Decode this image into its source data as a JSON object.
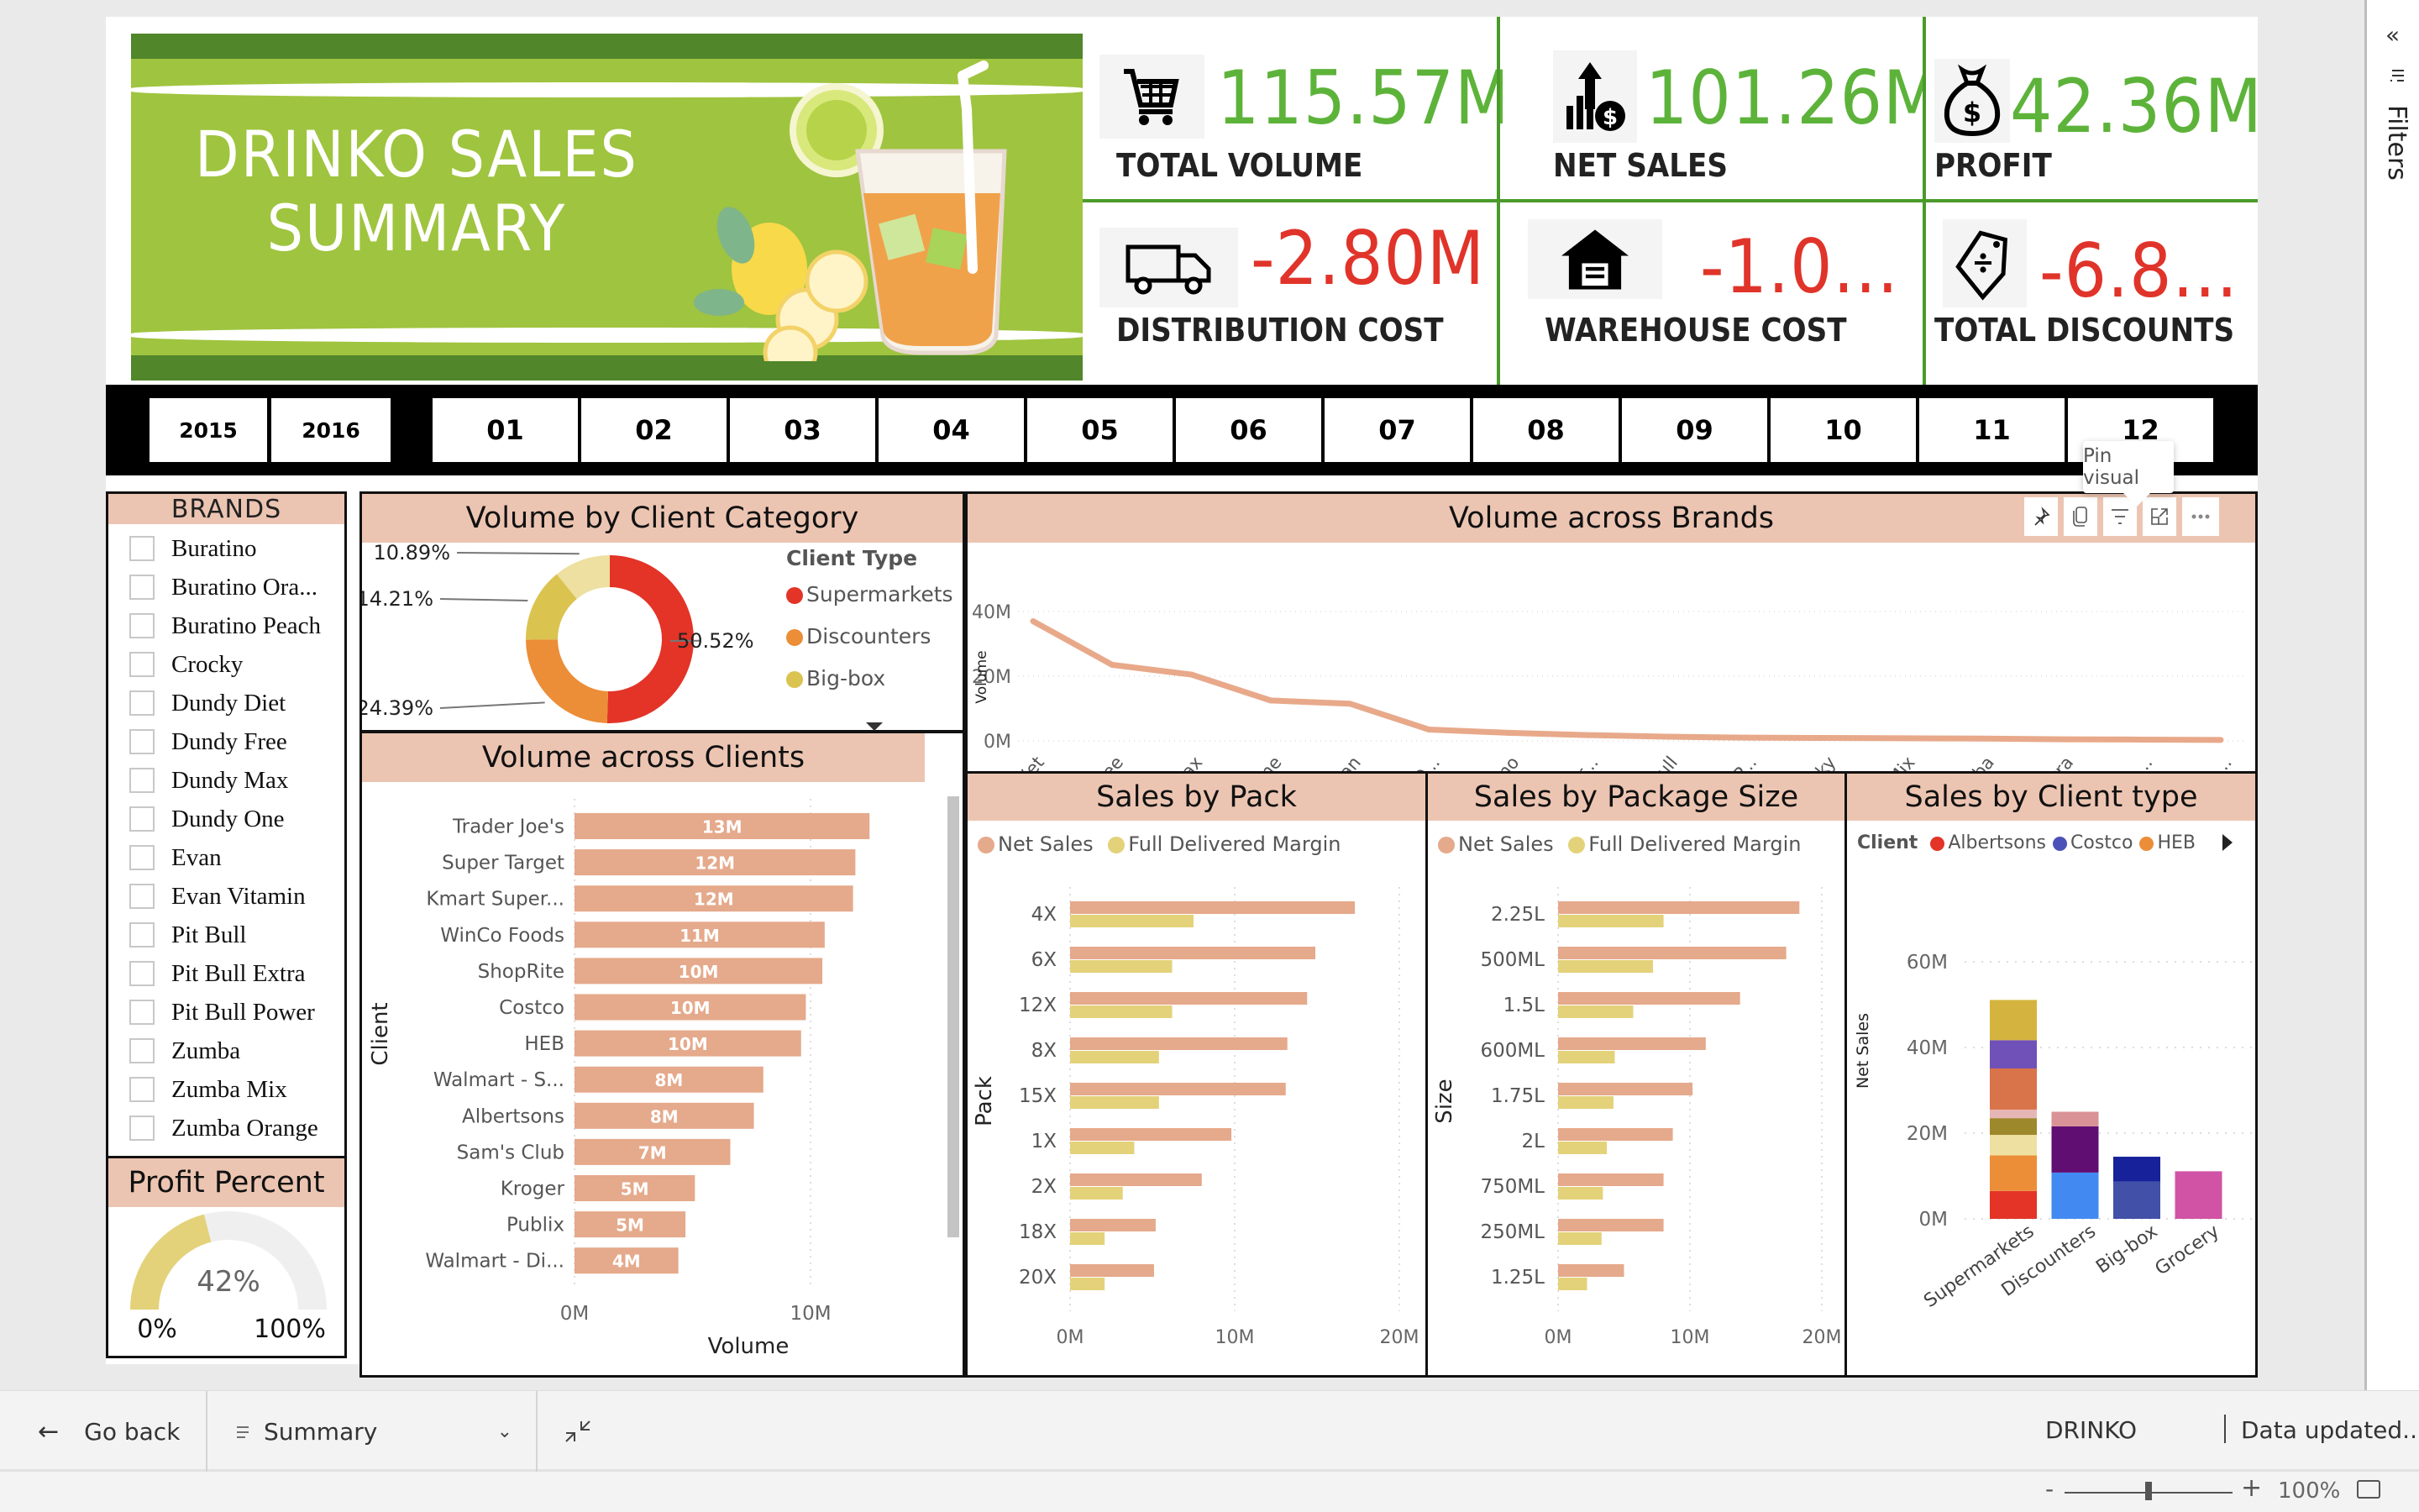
{
  "banner": {
    "title_line1": "DRINKO SALES",
    "title_line2": "SUMMARY"
  },
  "kpis": [
    {
      "id": "total-volume",
      "value": "115.57M",
      "label": "TOTAL VOLUME",
      "icon": "shopping-cart-icon",
      "color": "#5db33a"
    },
    {
      "id": "net-sales",
      "value": "101.26M",
      "label": "NET SALES",
      "icon": "growth-chart-dollar-icon",
      "color": "#5db33a"
    },
    {
      "id": "profit",
      "value": "42.36M",
      "label": "PROFIT",
      "icon": "money-bag-icon",
      "color": "#5db33a"
    },
    {
      "id": "distribution-cost",
      "value": "-2.80M",
      "label": "DISTRIBUTION COST",
      "icon": "delivery-truck-icon",
      "color": "#e0342a"
    },
    {
      "id": "warehouse-cost",
      "value": "-1.0...",
      "label": "WAREHOUSE COST",
      "icon": "warehouse-icon",
      "color": "#e0342a"
    },
    {
      "id": "total-discounts",
      "value": "-6.8...",
      "label": "TOTAL DISCOUNTS",
      "icon": "discount-tag-icon",
      "color": "#e0342a"
    }
  ],
  "years": [
    "2015",
    "2016"
  ],
  "months": [
    "01",
    "02",
    "03",
    "04",
    "05",
    "06",
    "07",
    "08",
    "09",
    "10",
    "11",
    "12"
  ],
  "brands_slicer": {
    "title": "BRANDS",
    "items": [
      "Buratino",
      "Buratino Ora...",
      "Buratino Peach",
      "Crocky",
      "Dundy Diet",
      "Dundy Free",
      "Dundy Max",
      "Dundy One",
      "Evan",
      "Evan Vitamin",
      "Pit Bull",
      "Pit Bull Extra",
      "Pit Bull Power",
      "Zumba",
      "Zumba Mix",
      "Zumba Orange"
    ]
  },
  "profit_gauge": {
    "title": "Profit Percent",
    "value_label": "42%",
    "value": 0.42,
    "min_label": "0%",
    "max_label": "100%",
    "fill_color": "#e3d27a"
  },
  "tooltip": {
    "text": "Pin visual"
  },
  "visual_header_icons": [
    "pin-icon",
    "copy-icon",
    "filter-icon",
    "focus-mode-icon",
    "more-options-icon"
  ],
  "bottom_bar": {
    "go_back": "Go back",
    "page": "Summary",
    "report_name": "DRINKO",
    "status": "Data updated...",
    "zoom": "100%",
    "zoom_level": 0.5
  },
  "filters_pane": {
    "label": "Filters"
  },
  "chart_data": [
    {
      "id": "volume-by-client-category",
      "type": "pie",
      "title": "Volume by Client Category",
      "legend_title": "Client Type",
      "legend": [
        {
          "name": "Supermarkets",
          "color": "#e33427"
        },
        {
          "name": "Discounters",
          "color": "#ec8d38"
        },
        {
          "name": "Big-box",
          "color": "#dbc350"
        }
      ],
      "slices": [
        {
          "name": "Supermarkets",
          "value": 50.52,
          "label": "50.52%",
          "color": "#e33427"
        },
        {
          "name": "Discounters",
          "value": 24.39,
          "label": "24.39%",
          "color": "#ec8d38"
        },
        {
          "name": "Big-box",
          "value": 14.21,
          "label": "14.21%",
          "color": "#dbc350"
        },
        {
          "name": "Grocery",
          "value": 10.89,
          "label": "10.89%",
          "color": "#ede0a0"
        }
      ]
    },
    {
      "id": "volume-across-brands",
      "type": "line",
      "title": "Volume across Brands",
      "ylabel": "Volume",
      "yticks": [
        "0M",
        "20M",
        "40M"
      ],
      "ylim": [
        0,
        40
      ],
      "categories": [
        "Dundy Diet",
        "Dundy Free",
        "Dundy Max",
        "Dundy One",
        "Evan",
        "Buratino O...",
        "Buratino",
        "Zumba Or...",
        "Pit Bull",
        "Buratino P...",
        "Crocky",
        "Zumba Mix",
        "Zumba",
        "Pit Bull Extra",
        "Pit Bull Po...",
        "Evan Vita..."
      ],
      "values": [
        37,
        23.5,
        20.5,
        12.5,
        11.5,
        3.5,
        2.5,
        1.8,
        1.3,
        1.0,
        0.9,
        0.8,
        0.7,
        0.5,
        0.4,
        0.3
      ],
      "color": "#e8a98a"
    },
    {
      "id": "volume-across-clients",
      "type": "bar",
      "title": "Volume across Clients",
      "xlabel": "Volume",
      "ylabel": "Client",
      "xticks": [
        "0M",
        "10M"
      ],
      "xlim": [
        0,
        14.5
      ],
      "categories": [
        "Trader Joe's",
        "Super Target",
        "Kmart Super...",
        "WinCo Foods",
        "ShopRite",
        "Costco",
        "HEB",
        "Walmart - S...",
        "Albertsons",
        "Sam's Club",
        "Kroger",
        "Publix",
        "Walmart - Di..."
      ],
      "values": [
        12.5,
        11.9,
        11.8,
        10.6,
        10.5,
        9.8,
        9.6,
        8.0,
        7.6,
        6.6,
        5.1,
        4.7,
        4.4
      ],
      "data_labels": [
        "13M",
        "12M",
        "12M",
        "11M",
        "10M",
        "10M",
        "10M",
        "8M",
        "8M",
        "7M",
        "5M",
        "5M",
        "4M"
      ],
      "color": "#e5a98b"
    },
    {
      "id": "sales-by-pack",
      "type": "bar",
      "title": "Sales by Pack",
      "ylabel": "Pack",
      "xticks": [
        "0M",
        "10M",
        "20M"
      ],
      "xlim": [
        0,
        20
      ],
      "categories": [
        "4X",
        "6X",
        "12X",
        "8X",
        "15X",
        "1X",
        "2X",
        "18X",
        "20X"
      ],
      "series": [
        {
          "name": "Net Sales",
          "color": "#e5a98b",
          "values": [
            17.3,
            14.9,
            14.4,
            13.2,
            13.1,
            9.8,
            8.0,
            5.2,
            5.1
          ]
        },
        {
          "name": "Full Delivered Margin",
          "color": "#e3d27a",
          "values": [
            7.5,
            6.2,
            6.2,
            5.4,
            5.4,
            3.9,
            3.2,
            2.1,
            2.1
          ]
        }
      ]
    },
    {
      "id": "sales-by-package-size",
      "type": "bar",
      "title": "Sales by Package Size",
      "ylabel": "Size",
      "xticks": [
        "0M",
        "10M",
        "20M"
      ],
      "xlim": [
        0,
        20
      ],
      "categories": [
        "2.25L",
        "500ML",
        "1.5L",
        "600ML",
        "1.75L",
        "2L",
        "750ML",
        "250ML",
        "1.25L"
      ],
      "series": [
        {
          "name": "Net Sales",
          "color": "#e5a98b",
          "values": [
            18.3,
            17.3,
            13.8,
            11.2,
            10.2,
            8.7,
            8.0,
            8.0,
            5.0
          ]
        },
        {
          "name": "Full Delivered Margin",
          "color": "#e3d27a",
          "values": [
            8.0,
            7.2,
            5.7,
            4.3,
            4.2,
            3.7,
            3.4,
            3.3,
            2.2
          ]
        }
      ]
    },
    {
      "id": "sales-by-client-type",
      "type": "bar",
      "stacked": true,
      "title": "Sales by Client type",
      "ylabel": "Net Sales",
      "legend_title": "Client",
      "legend": [
        {
          "name": "Albertsons",
          "color": "#e33427"
        },
        {
          "name": "Costco",
          "color": "#4a52b8"
        },
        {
          "name": "HEB",
          "color": "#ec8d38"
        }
      ],
      "yticks": [
        "0M",
        "20M",
        "40M",
        "60M"
      ],
      "ylim": [
        0,
        60
      ],
      "categories": [
        "Supermarkets",
        "Discounters",
        "Big-box",
        "Grocery"
      ],
      "stacks": [
        [
          {
            "v": 6.5,
            "c": "#e33427"
          },
          {
            "v": 8.3,
            "c": "#ec8d38"
          },
          {
            "v": 4.8,
            "c": "#ede0a0"
          },
          {
            "v": 3.9,
            "c": "#9e882c"
          },
          {
            "v": 2.0,
            "c": "#e6b5b5"
          },
          {
            "v": 9.6,
            "c": "#d9734a"
          },
          {
            "v": 6.6,
            "c": "#7051b8"
          },
          {
            "v": 9.4,
            "c": "#d4b43e"
          }
        ],
        [
          {
            "v": 10.8,
            "c": "#428af2"
          },
          {
            "v": 10.8,
            "c": "#600e72"
          },
          {
            "v": 3.4,
            "c": "#d99295"
          }
        ],
        [
          {
            "v": 8.7,
            "c": "#4250a8"
          },
          {
            "v": 5.8,
            "c": "#17219a"
          }
        ],
        [
          {
            "v": 11.1,
            "c": "#d053a5"
          }
        ]
      ]
    }
  ]
}
